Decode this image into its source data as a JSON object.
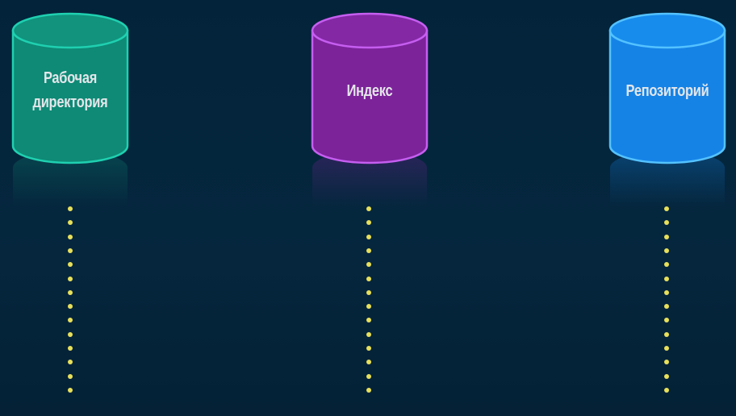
{
  "nodes": [
    {
      "id": "working-dir",
      "lines": [
        "Рабочая",
        "директория"
      ],
      "fill": "#0e8a76",
      "top": "#11937e",
      "edge": "#1fd0b0"
    },
    {
      "id": "index",
      "lines": [
        "Индекс"
      ],
      "fill": "#7c239a",
      "top": "#8428a4",
      "edge": "#c55ef0"
    },
    {
      "id": "repository",
      "lines": [
        "Репозиторий"
      ],
      "fill": "#1583e6",
      "top": "#178ced",
      "edge": "#54c2ff"
    }
  ],
  "connector_color": "#e8e05a",
  "background_color": "#03233a"
}
